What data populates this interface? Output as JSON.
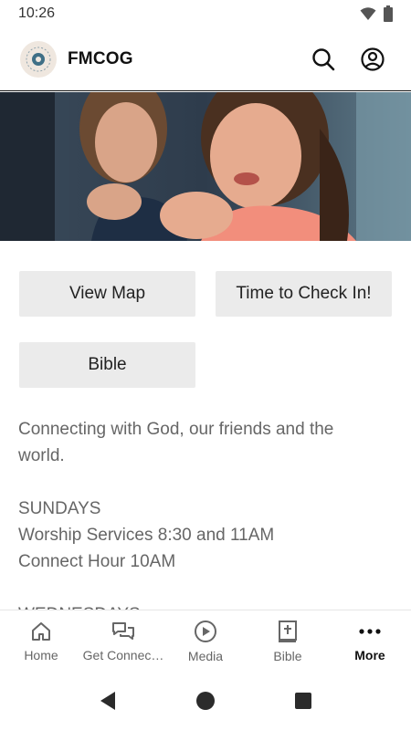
{
  "status_bar": {
    "time": "10:26"
  },
  "header": {
    "title": "FMCOG"
  },
  "buttons": {
    "view_map": "View Map",
    "check_in": "Time to Check In!",
    "bible": "Bible"
  },
  "content": {
    "intro_1": "Connecting with God, our friends and the",
    "intro_2": "world.",
    "sundays_heading": "SUNDAYS",
    "sundays_line_1": "Worship Services 8:30 and 11AM",
    "sundays_line_2": "Connect Hour 10AM",
    "wednesdays_heading": "WEDNESDAYS"
  },
  "bottom_nav": [
    {
      "label": "Home",
      "icon": "home-icon"
    },
    {
      "label": "Get Connec…",
      "icon": "chat-bubbles-icon"
    },
    {
      "label": "Media",
      "icon": "play-circle-icon"
    },
    {
      "label": "Bible",
      "icon": "bible-icon"
    },
    {
      "label": "More",
      "icon": "more-dots-icon",
      "active": true
    }
  ],
  "colors": {
    "accent_text": "#111111",
    "muted_text": "#666666",
    "button_bg": "#ebebeb"
  }
}
